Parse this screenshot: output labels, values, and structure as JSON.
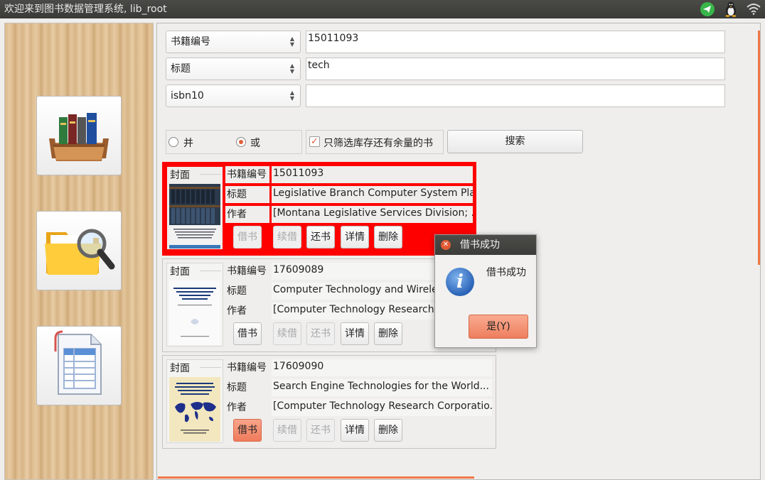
{
  "window": {
    "title": "欢迎来到图书数据管理系统, lib_root"
  },
  "tray": {
    "icons": [
      "telegram-icon",
      "tux-icon",
      "wifi-icon"
    ]
  },
  "sidebar": {
    "items": [
      {
        "name": "library-books"
      },
      {
        "name": "search-folder"
      },
      {
        "name": "records-table"
      }
    ]
  },
  "search": {
    "rows": [
      {
        "field": "书籍编号",
        "value": "15011093"
      },
      {
        "field": "标题",
        "value": "tech"
      },
      {
        "field": "isbn10",
        "value": ""
      }
    ],
    "logic": {
      "and_label": "并",
      "or_label": "或",
      "selected": "或"
    },
    "stock_filter": {
      "label": "只筛选库存还有余量的书",
      "checked": true
    },
    "search_label": "搜索"
  },
  "results": [
    {
      "cover_label": "封面",
      "id_label": "书籍编号",
      "id": "15011093",
      "title_label": "标题",
      "title": "Legislative Branch Computer System Plan",
      "author_label": "作者",
      "author": "[Montana Legislative Services Division; ...",
      "selected": true,
      "actions": [
        {
          "label": "借书",
          "enabled": false
        },
        {
          "label": "续借",
          "enabled": false
        },
        {
          "label": "还书",
          "enabled": true
        },
        {
          "label": "详情",
          "enabled": true
        },
        {
          "label": "删除",
          "enabled": true
        }
      ]
    },
    {
      "cover_label": "封面",
      "id_label": "书籍编号",
      "id": "17609089",
      "title_label": "标题",
      "title": "Computer Technology and Wireless Technologies",
      "author_label": "作者",
      "author": "[Computer Technology Research Corporation]",
      "selected": false,
      "actions": [
        {
          "label": "借书",
          "enabled": true
        },
        {
          "label": "续借",
          "enabled": false
        },
        {
          "label": "还书",
          "enabled": false
        },
        {
          "label": "详情",
          "enabled": true
        },
        {
          "label": "删除",
          "enabled": true
        }
      ]
    },
    {
      "cover_label": "封面",
      "id_label": "书籍编号",
      "id": "17609090",
      "title_label": "标题",
      "title": "Search Engine Technologies for the World...",
      "author_label": "作者",
      "author": "[Computer Technology Research Corporatio...",
      "selected": false,
      "actions": [
        {
          "label": "借书",
          "enabled": true
        },
        {
          "label": "续借",
          "enabled": false
        },
        {
          "label": "还书",
          "enabled": false
        },
        {
          "label": "详情",
          "enabled": true
        },
        {
          "label": "删除",
          "enabled": true
        }
      ]
    }
  ],
  "dialog": {
    "title": "借书成功",
    "message": "借书成功",
    "ok_label": "是(Y)"
  },
  "colors": {
    "accent": "#f07746",
    "selected_card": "#ff0000",
    "titlebar": "#3c3c39"
  }
}
